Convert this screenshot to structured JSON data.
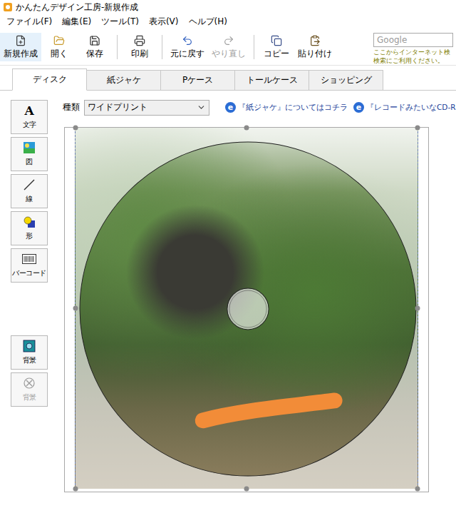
{
  "window": {
    "title": "かんたんデザイン工房-新規作成"
  },
  "menu": [
    "ファイル(F)",
    "編集(E)",
    "ツール(T)",
    "表示(V)",
    "ヘルプ(H)"
  ],
  "toolbar_groups": [
    {
      "buttons": [
        {
          "label": "新規作成",
          "disabled": false
        },
        {
          "label": "開く",
          "disabled": false
        },
        {
          "label": "保存",
          "disabled": false
        }
      ]
    },
    {
      "buttons": [
        {
          "label": "印刷",
          "disabled": false
        }
      ]
    },
    {
      "buttons": [
        {
          "label": "元に戻す",
          "disabled": false
        },
        {
          "label": "やり直し",
          "disabled": true
        }
      ]
    },
    {
      "buttons": [
        {
          "label": "コピー",
          "disabled": false
        },
        {
          "label": "貼り付け",
          "disabled": false
        }
      ]
    }
  ],
  "search": {
    "placeholder": "Google",
    "hint": [
      "ここからインターネット検",
      "検索にご利用ください。"
    ]
  },
  "tabs": [
    {
      "label": "ディスク",
      "selected": true
    },
    {
      "label": "紙ジャケ",
      "selected": false
    },
    {
      "label": "Pケース",
      "selected": false
    },
    {
      "label": "トールケース",
      "selected": false
    },
    {
      "label": "ショッピング",
      "selected": false
    }
  ],
  "tools": [
    {
      "label": "文字",
      "icon_text": "A"
    },
    {
      "label": "図"
    },
    {
      "label": "線"
    },
    {
      "label": "形"
    },
    {
      "label": "バーコード"
    }
  ],
  "background_buttons": [
    {
      "label": "背景",
      "disabled": false
    },
    {
      "label": "背景",
      "disabled": true
    }
  ],
  "kind": {
    "label": "種類",
    "value": "ワイドプリント"
  },
  "links": [
    {
      "icon_text": "e",
      "label": "『紙ジャケ』についてはコチラ"
    },
    {
      "icon_text": "e",
      "label": "『レコードみたいなCD-R"
    }
  ]
}
